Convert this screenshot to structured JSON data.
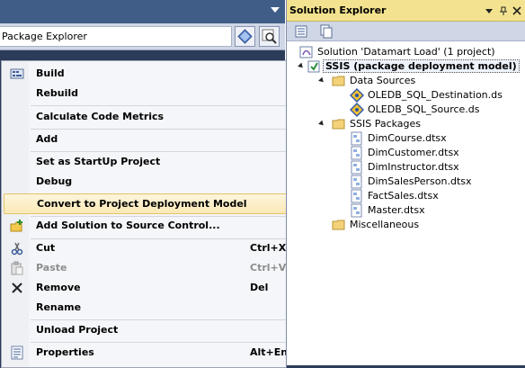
{
  "left_pane": {
    "package_explorer_label": "Package Explorer"
  },
  "context_menu": {
    "items": [
      {
        "label": "Build",
        "icon": "build-icon"
      },
      {
        "label": "Rebuild"
      },
      {
        "label": "Calculate Code Metrics"
      },
      {
        "label": "Add",
        "submenu": true
      },
      {
        "label": "Set as StartUp Project"
      },
      {
        "label": "Debug",
        "submenu": true
      },
      {
        "label": "Convert to Project Deployment Model",
        "highlighted": true
      },
      {
        "label": "Add Solution to Source Control...",
        "icon": "source-control-icon"
      },
      {
        "label": "Cut",
        "shortcut": "Ctrl+X",
        "icon": "scissors-icon"
      },
      {
        "label": "Paste",
        "shortcut": "Ctrl+V",
        "icon": "paste-icon",
        "disabled": true
      },
      {
        "label": "Remove",
        "shortcut": "Del",
        "icon": "remove-icon"
      },
      {
        "label": "Rename"
      },
      {
        "label": "Unload Project"
      },
      {
        "label": "Properties",
        "shortcut": "Alt+Enter",
        "icon": "properties-icon"
      }
    ]
  },
  "solution_explorer": {
    "title": "Solution Explorer",
    "solution_label": "Solution 'Datamart Load' (1 project)",
    "project_label": "SSIS (package deployment model)",
    "folders": {
      "data_sources": "Data Sources",
      "ssis_packages": "SSIS Packages",
      "miscellaneous": "Miscellaneous"
    },
    "data_sources": [
      "OLEDB_SQL_Destination.ds",
      "OLEDB_SQL_Source.ds"
    ],
    "packages": [
      "DimCourse.dtsx",
      "DimCustomer.dtsx",
      "DimInstructor.dtsx",
      "DimSalesPerson.dtsx",
      "FactSales.dtsx",
      "Master.dtsx"
    ]
  },
  "colors": {
    "ide_background": "#2b3c59",
    "title_bar": "#f3e28f",
    "highlight_fill": "#fbe9b6",
    "highlight_border": "#e5c365"
  }
}
